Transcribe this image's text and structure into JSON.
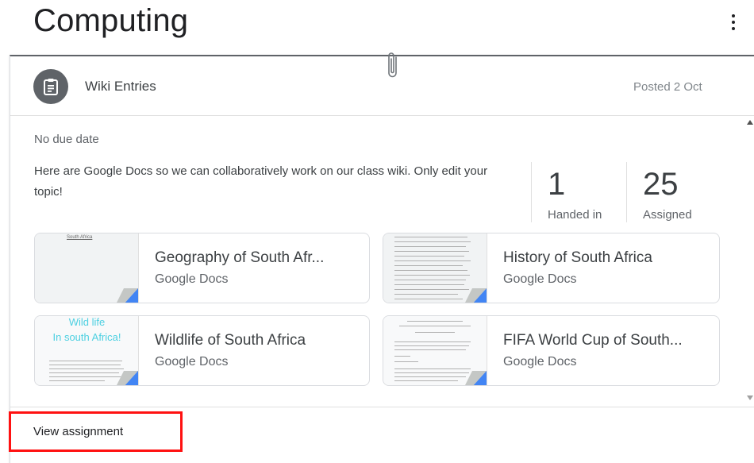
{
  "page": {
    "title": "Computing",
    "more_icon": "more-vert-icon"
  },
  "card": {
    "header": {
      "icon": "assignment-icon",
      "title": "Wiki Entries",
      "posted": "Posted 2 Oct"
    },
    "due": "No due date",
    "description": "Here are Google Docs so we can collaboratively work on our class wiki. Only edit your topic!",
    "stats": [
      {
        "number": "1",
        "label": "Handed in"
      },
      {
        "number": "25",
        "label": "Assigned"
      }
    ],
    "attachments": [
      {
        "title": "Geography of South Afr...",
        "type": "Google Docs",
        "thumb_heading": "South Africa"
      },
      {
        "title": "History of South Africa",
        "type": "Google Docs"
      },
      {
        "title": "Wildlife of South Africa",
        "type": "Google Docs",
        "thumb_heading": "Wild life",
        "thumb_subheading": "In south Africa!"
      },
      {
        "title": "FIFA World Cup of South...",
        "type": "Google Docs"
      }
    ],
    "footer": {
      "view_label": "View assignment"
    }
  },
  "colors": {
    "accent": "#ff1111",
    "doc_corner": "#4285f4",
    "icon_circle": "#5f6368",
    "thumb_text": "#4dd0e1"
  }
}
